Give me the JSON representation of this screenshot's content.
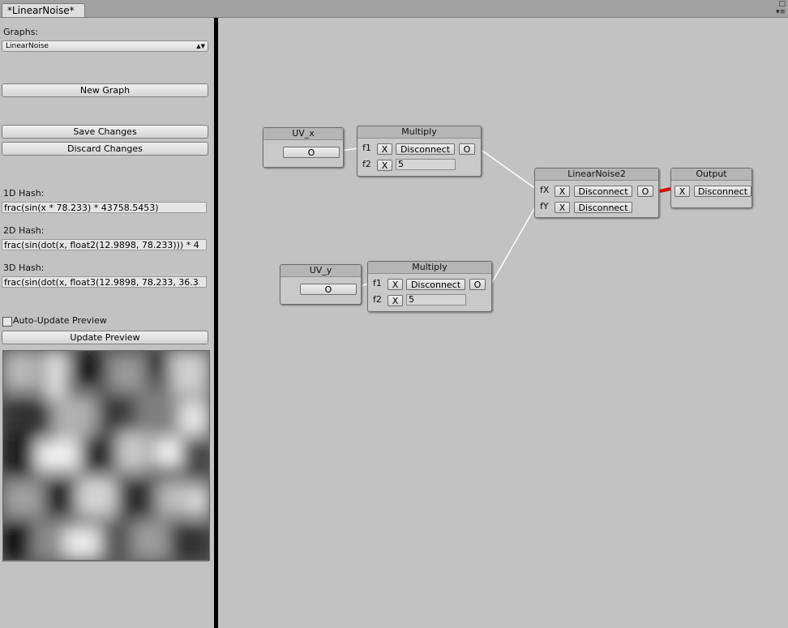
{
  "window": {
    "tab_title": "*LinearNoise*"
  },
  "sidebar": {
    "graphs_label": "Graphs:",
    "graph_select_value": "LinearNoise",
    "new_graph_label": "New Graph",
    "save_changes_label": "Save Changes",
    "discard_changes_label": "Discard Changes",
    "hash_1d_label": "1D Hash:",
    "hash_1d_value": "frac(sin(x * 78.233) * 43758.5453)",
    "hash_2d_label": "2D Hash:",
    "hash_2d_value": "frac(sin(dot(x, float2(12.9898, 78.233))) * 4",
    "hash_3d_label": "3D Hash:",
    "hash_3d_value": "frac(sin(dot(x, float3(12.9898, 78.233, 36.3",
    "auto_update_label": "Auto-Update Preview",
    "auto_update_checked": false,
    "update_preview_label": "Update Preview"
  },
  "graph": {
    "uv_x": {
      "title": "UV_x",
      "output_label": "O"
    },
    "uv_y": {
      "title": "UV_y",
      "output_label": "O"
    },
    "multiply_1": {
      "title": "Multiply",
      "f1_label": "f1",
      "f2_label": "f2",
      "x_label": "X",
      "disconnect_label": "Disconnect",
      "output_label": "O",
      "f2_value": "5"
    },
    "multiply_2": {
      "title": "Multiply",
      "f1_label": "f1",
      "f2_label": "f2",
      "x_label": "X",
      "disconnect_label": "Disconnect",
      "output_label": "O",
      "f2_value": "5"
    },
    "linear_noise": {
      "title": "LinearNoise2",
      "fx_label": "fX",
      "fy_label": "fY",
      "x_label": "X",
      "disconnect_label": "Disconnect",
      "output_label": "O"
    },
    "output": {
      "title": "Output",
      "x_label": "X",
      "disconnect_label": "Disconnect"
    },
    "colors": {
      "wire": "#ffffff",
      "selected_wire": "#e00000"
    }
  }
}
